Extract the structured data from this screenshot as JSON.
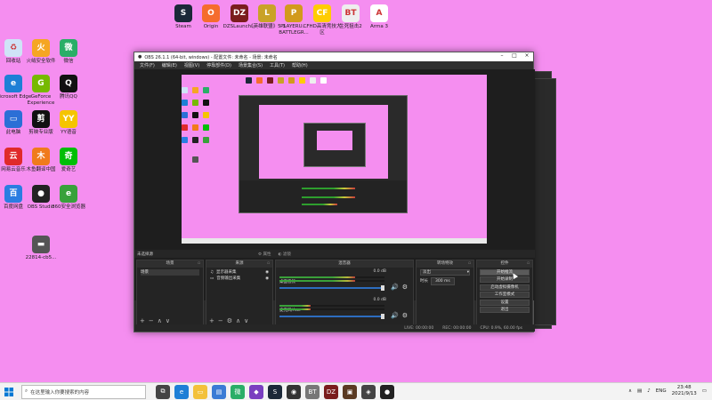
{
  "desktop_icons": [
    {
      "label": "Steam",
      "color": "#1b2838",
      "glyph": "S"
    },
    {
      "label": "Origin",
      "color": "#f56c2d",
      "glyph": "O"
    },
    {
      "label": "DZSLaunch...",
      "color": "#7a1d1d",
      "glyph": "DZ"
    },
    {
      "label": "《英雄联盟》5 3",
      "color": "#c9a227",
      "glyph": "L"
    },
    {
      "label": "PLAYERU... BATTLEGR...",
      "color": "#d29a1c",
      "glyph": "P"
    },
    {
      "label": "CFHD高清竞技大区",
      "color": "#ffcc00",
      "glyph": "CF"
    },
    {
      "label": "生死狙击2",
      "color": "#eee",
      "glyph": "BT"
    },
    {
      "label": "Arma 3",
      "color": "#ffffff",
      "glyph": "A"
    },
    {
      "label": "回收站",
      "color": "#cfe3f7",
      "glyph": "♻"
    },
    {
      "label": "火绒安全软件",
      "color": "#f5a623",
      "glyph": "火"
    },
    {
      "label": "微信",
      "color": "#2aae67",
      "glyph": "微"
    },
    {
      "label": "Microsoft Edge",
      "color": "#1e7fd6",
      "glyph": "e"
    },
    {
      "label": "GeForce Experience",
      "color": "#76b900",
      "glyph": "G"
    },
    {
      "label": "腾讯QQ",
      "color": "#111",
      "glyph": "Q"
    },
    {
      "label": "此电脑",
      "color": "#2b6fd6",
      "glyph": "▭"
    },
    {
      "label": "剪映专业版",
      "color": "#111",
      "glyph": "剪"
    },
    {
      "label": "YY语音",
      "color": "#f5c400",
      "glyph": "YY"
    },
    {
      "label": "网易云音乐",
      "color": "#e02a2a",
      "glyph": "云"
    },
    {
      "label": "木鱼翻译中国",
      "color": "#f07b1c",
      "glyph": "木"
    },
    {
      "label": "爱奇艺",
      "color": "#00be06",
      "glyph": "奇"
    },
    {
      "label": "百度网盘",
      "color": "#2a7de1",
      "glyph": "百"
    },
    {
      "label": "OBS Studio",
      "color": "#222",
      "glyph": "●"
    },
    {
      "label": "360安全浏览器",
      "color": "#38a13b",
      "glyph": "e"
    },
    {
      "label": "22814-cb5...",
      "color": "#555",
      "glyph": "▬"
    }
  ],
  "obs": {
    "title": "OBS 26.1.1 (64-bit, windows) - 配置文件: 未命名 - 场景: 未命名",
    "menu": [
      "文件(F)",
      "编辑(E)",
      "视图(V)",
      "停靠部件(D)",
      "场景集合(S)",
      "工具(T)",
      "帮助(H)"
    ],
    "toolbar": {
      "source_none": "未选择源",
      "properties": "属性",
      "filters": "滤镜"
    },
    "docks": {
      "scenes": {
        "title": "场景",
        "items": [
          "场景"
        ]
      },
      "sources": {
        "title": "来源",
        "items": [
          "显示器采集",
          "音频输出采集"
        ]
      },
      "mixer": {
        "title": "混音器",
        "tracks": [
          {
            "name": "桌面音频",
            "value": "0.0 dB",
            "level": 0.72
          },
          {
            "name": "麦克风/Aux",
            "value": "0.0 dB",
            "level": 0.3
          }
        ]
      },
      "transitions": {
        "title": "转场特效",
        "type": "淡出",
        "duration_label": "时长",
        "duration": "300 ms"
      },
      "controls": {
        "title": "控件",
        "buttons": [
          "开始推流",
          "开始录制",
          "启动虚拟摄像机",
          "工作室模式",
          "设置",
          "退出"
        ]
      }
    },
    "status": {
      "live": "LIVE: 00:00:00",
      "rec": "REC: 00:00:00",
      "cpu": "CPU: 0.9%, 60.00 fps"
    }
  },
  "taskbar": {
    "search_placeholder": "在这里输入你要搜索的内容",
    "apps": [
      {
        "name": "task-view",
        "color": "#444",
        "glyph": "⧉"
      },
      {
        "name": "edge",
        "color": "#1e7fd6",
        "glyph": "e"
      },
      {
        "name": "file-explorer",
        "color": "#f3c13a",
        "glyph": "▭"
      },
      {
        "name": "store",
        "color": "#3a7bd5",
        "glyph": "▤"
      },
      {
        "name": "wechat",
        "color": "#2aae67",
        "glyph": "微"
      },
      {
        "name": "visual-studio",
        "color": "#7a3fc0",
        "glyph": "◆"
      },
      {
        "name": "steam",
        "color": "#1b2838",
        "glyph": "S"
      },
      {
        "name": "dota",
        "color": "#333",
        "glyph": "◉"
      },
      {
        "name": "bt-game",
        "color": "#777",
        "glyph": "BT"
      },
      {
        "name": "dzs",
        "color": "#7a1d1d",
        "glyph": "DZ"
      },
      {
        "name": "media",
        "color": "#5a3a22",
        "glyph": "▣"
      },
      {
        "name": "game2",
        "color": "#444",
        "glyph": "◈"
      },
      {
        "name": "obs",
        "color": "#222",
        "glyph": "●"
      }
    ],
    "lang": "ENG",
    "time": "23:48",
    "date": "2021/9/13"
  }
}
